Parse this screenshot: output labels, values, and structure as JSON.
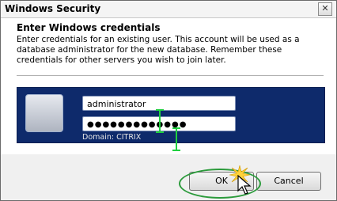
{
  "window": {
    "title": "Windows Security",
    "close_glyph": "✕"
  },
  "dialog": {
    "heading": "Enter Windows credentials",
    "description": "Enter credentials for an existing user. This account will be used as a database administrator for the new database. Remember these credentials for other servers you wish to join later."
  },
  "credentials": {
    "username": "administrator",
    "password_mask": "●●●●●●●●●●●●●",
    "domain_text": "Domain: CITRIX"
  },
  "buttons": {
    "ok_label": "OK",
    "cancel_label": "Cancel"
  },
  "colors": {
    "credential_panel": "#0e2a6b",
    "annotation_green": "#2c9b3c"
  },
  "icons": {
    "user_tile": "user-tile-icon",
    "cursor": "mouse-pointer-icon",
    "click": "click-burst-icon",
    "text_cursor": "ibeam-icon"
  }
}
